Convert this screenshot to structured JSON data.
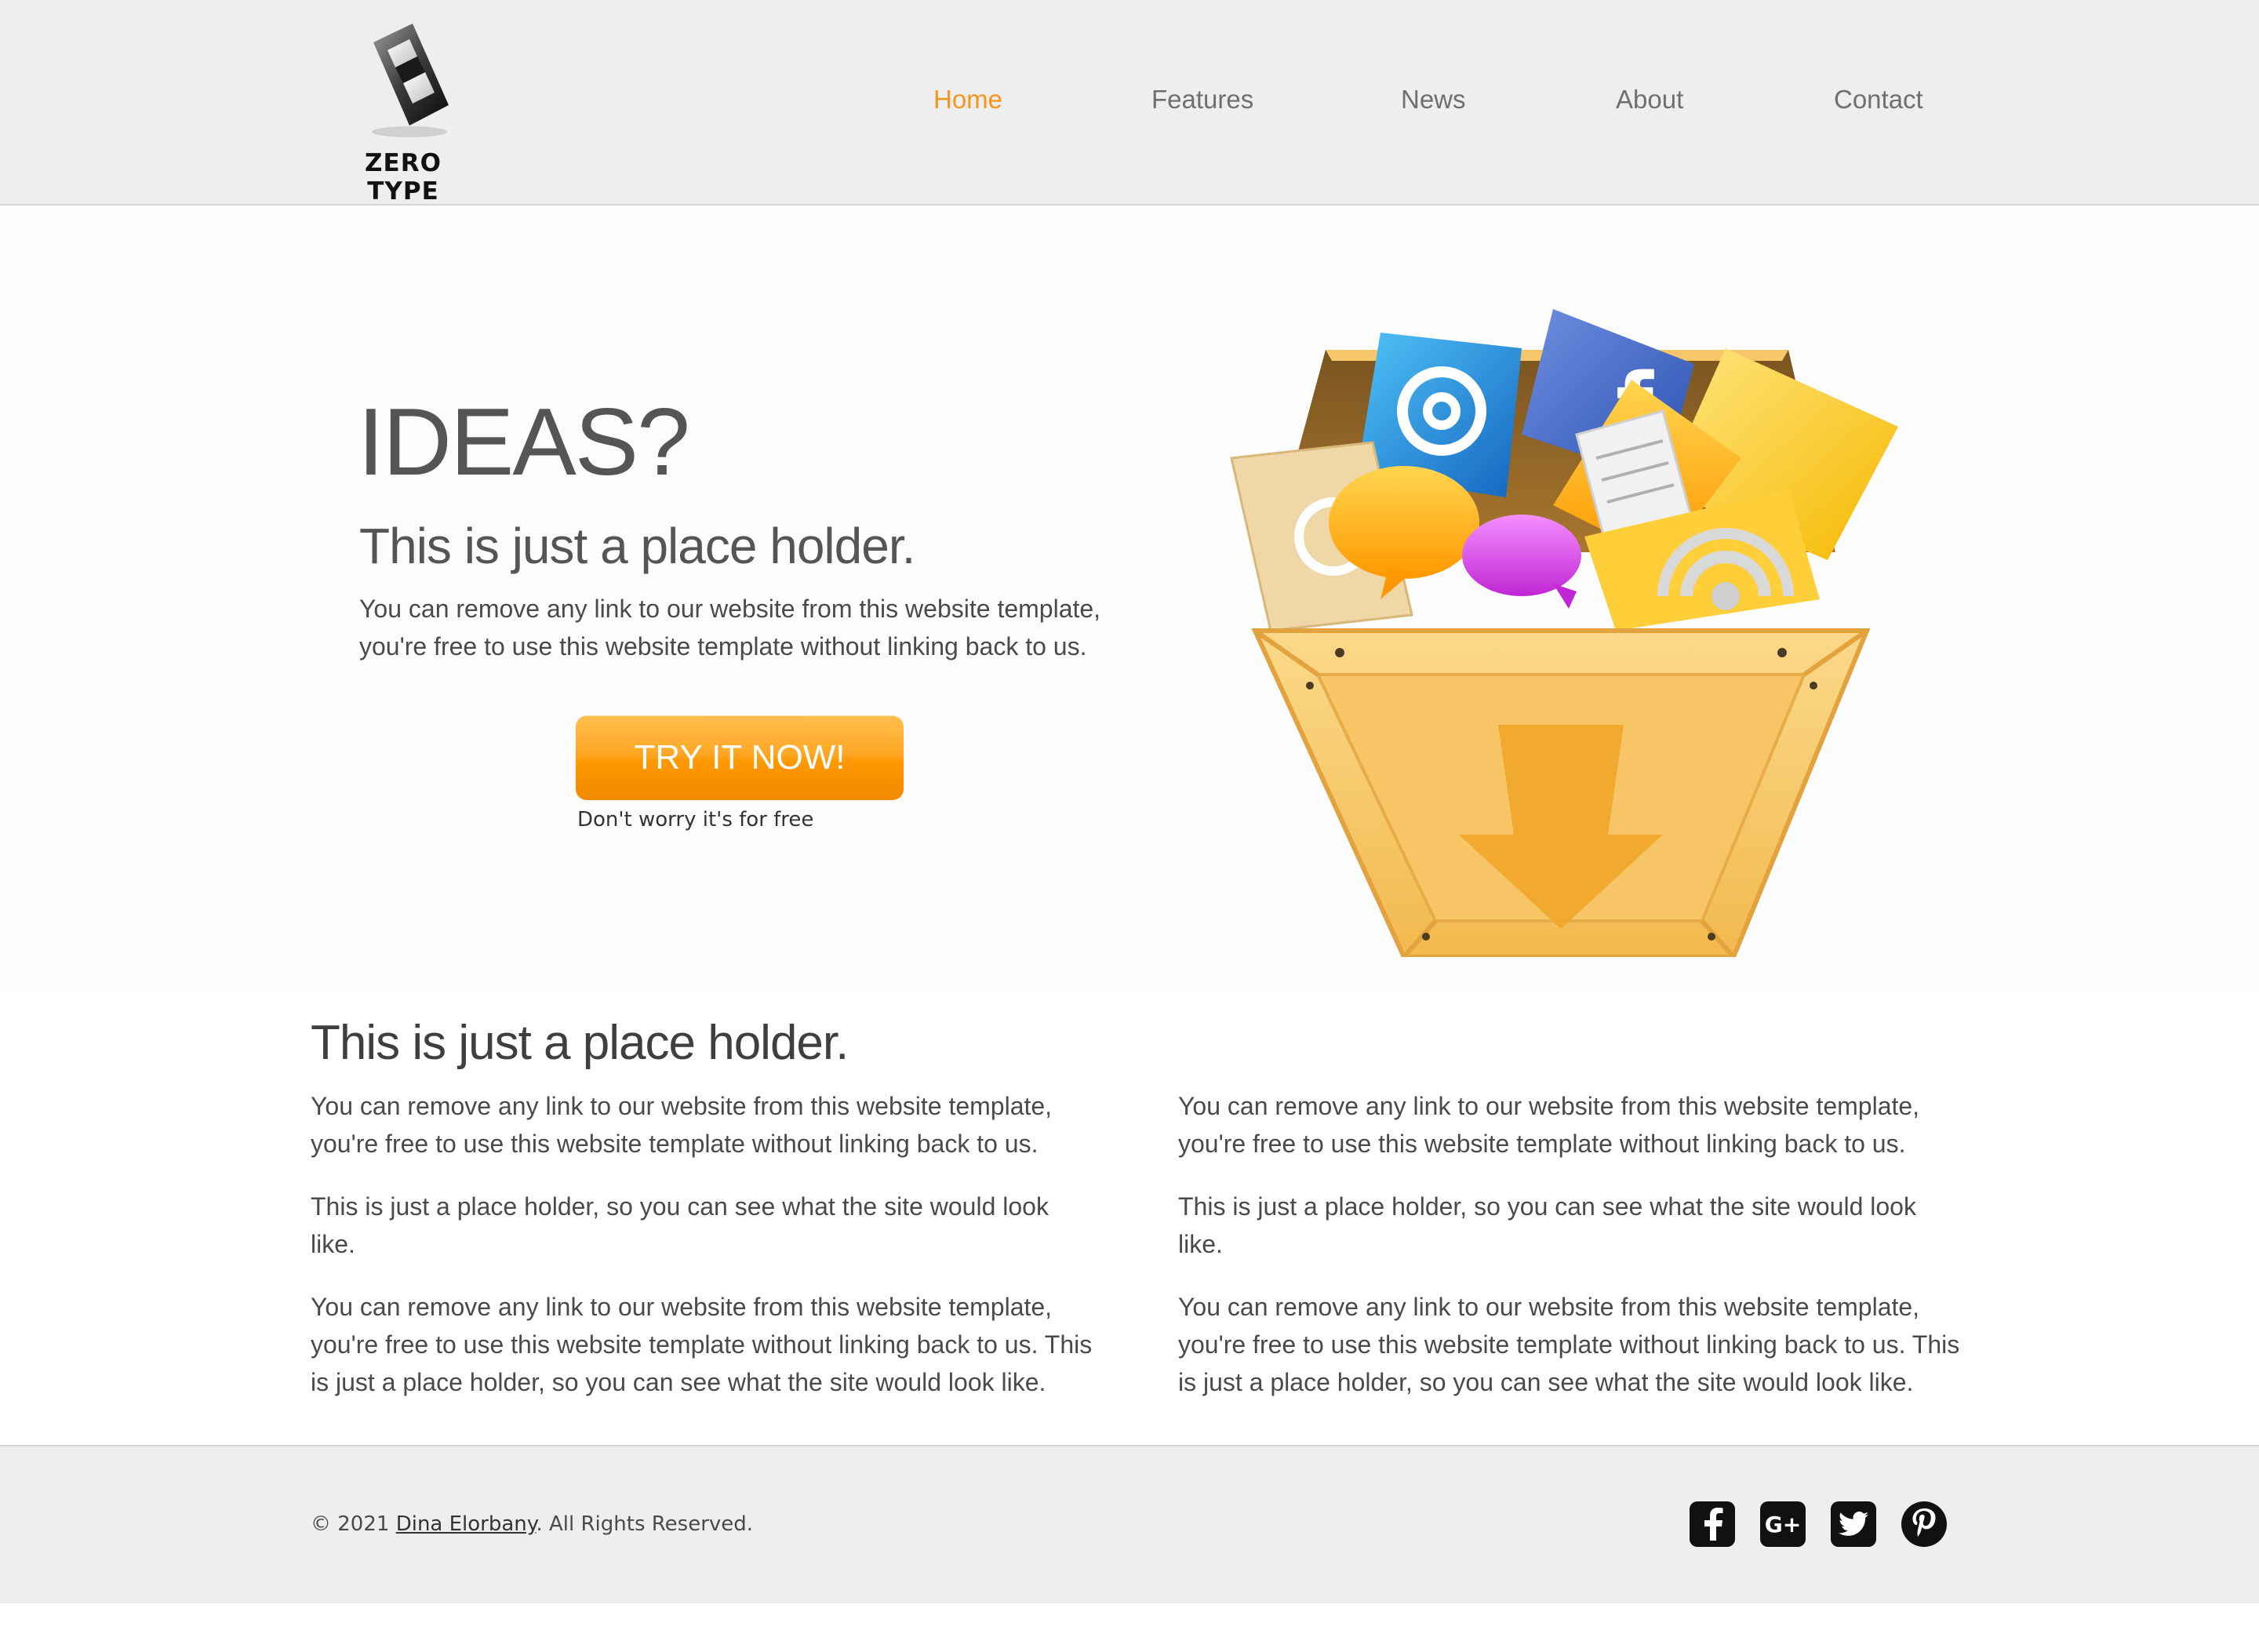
{
  "header": {
    "logo_text": "ZERO TYPE",
    "nav": [
      {
        "label": "Home",
        "active": true
      },
      {
        "label": "Features",
        "active": false
      },
      {
        "label": "News",
        "active": false
      },
      {
        "label": "About",
        "active": false
      },
      {
        "label": "Contact",
        "active": false
      }
    ]
  },
  "hero": {
    "title": "IDEAS?",
    "subtitle": "This is just a place holder.",
    "text_line1": "You can remove any link to our website from this website template,",
    "text_line2": "you're free to use this website template without linking back to us.",
    "cta_label": "TRY IT NOW!",
    "cta_note": "Don't worry it's for free"
  },
  "content": {
    "title": "This is just a place holder.",
    "left": [
      "You can remove any link to our website from this website template, you're free to use this website template without linking back to us.",
      "This is just a place holder, so you can see what the site would look like.",
      "You can remove any link to our website from this website template, you're free to use this website template without linking back to us. This is just a place holder, so you can see what the site would look like."
    ],
    "right": [
      "You can remove any link to our website from this website template, you're free to use this website template without linking back to us.",
      "This is just a place holder, so you can see what the site would look like.",
      "You can remove any link to our website from this website template, you're free to use this website template without linking back to us. This is just a place holder, so you can see what the site would look like."
    ]
  },
  "footer": {
    "copyright_prefix": "© 2021 ",
    "author": "Dina Elorbany",
    "copyright_suffix": ". All Rights Reserved.",
    "social": [
      "facebook-icon",
      "google-plus-icon",
      "twitter-icon",
      "pinterest-icon"
    ],
    "social_gplus_text": "G+"
  },
  "colors": {
    "accent": "#f7941d",
    "header_bg": "#eeeeee",
    "hero_bg": "#fcfcfc"
  }
}
